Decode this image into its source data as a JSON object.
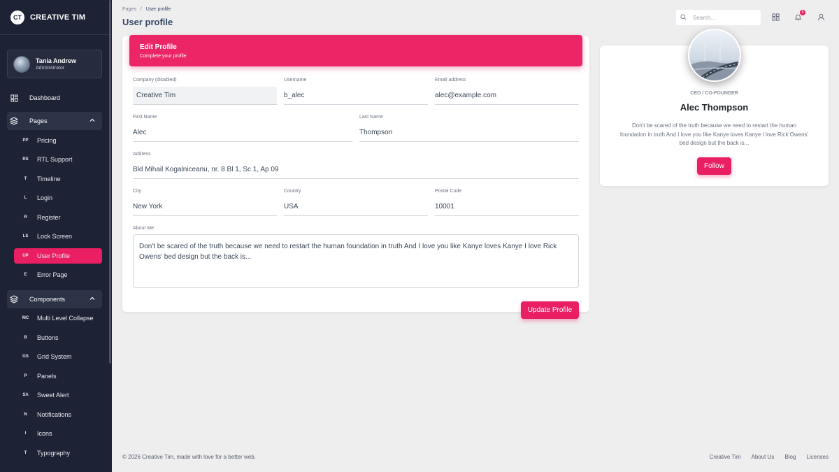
{
  "brand": {
    "logo": "CT",
    "name": "CREATIVE TIM"
  },
  "user": {
    "name": "Tania Andrew",
    "role": "Administrator"
  },
  "nav": {
    "dashboard": "Dashboard",
    "pages": "Pages",
    "components": "Components",
    "pages_items": [
      {
        "abbr": "PP",
        "label": "Pricing"
      },
      {
        "abbr": "RS",
        "label": "RTL Support"
      },
      {
        "abbr": "T",
        "label": "Timeline"
      },
      {
        "abbr": "L",
        "label": "Login"
      },
      {
        "abbr": "R",
        "label": "Register"
      },
      {
        "abbr": "LS",
        "label": "Lock Screen"
      },
      {
        "abbr": "UP",
        "label": "User Profile"
      },
      {
        "abbr": "E",
        "label": "Error Page"
      }
    ],
    "component_items": [
      {
        "abbr": "MC",
        "label": "Multi Level Collapse"
      },
      {
        "abbr": "B",
        "label": "Buttons"
      },
      {
        "abbr": "GS",
        "label": "Grid System"
      },
      {
        "abbr": "P",
        "label": "Panels"
      },
      {
        "abbr": "SA",
        "label": "Sweet Alert"
      },
      {
        "abbr": "N",
        "label": "Notifications"
      },
      {
        "abbr": "I",
        "label": "Icons"
      },
      {
        "abbr": "T",
        "label": "Typography"
      }
    ]
  },
  "header": {
    "breadcrumb_root": "Pages",
    "breadcrumb_sep": "/",
    "breadcrumb_current": "User profile",
    "title": "User profile",
    "search_placeholder": "Search...",
    "notification_count": "5"
  },
  "edit_profile": {
    "title": "Edit Profile",
    "subtitle": "Complete your profile",
    "company_label": "Company (disabled)",
    "company_value": "Creative Tim",
    "username_label": "Username",
    "username_value": "b_alec",
    "email_label": "Email address",
    "email_value": "alec@example.com",
    "first_label": "First Name",
    "first_value": "Alec",
    "last_label": "Last Name",
    "last_value": "Thompson",
    "address_label": "Address",
    "address_value": "Bld Mihail Kogalniceanu, nr. 8 Bl 1, Sc 1, Ap 09",
    "city_label": "City",
    "city_value": "New York",
    "country_label": "Country",
    "country_value": "USA",
    "postal_label": "Postal Code",
    "postal_value": "10001",
    "about_label": "About Me",
    "about_value": "Don't be scared of the truth because we need to restart the human foundation in truth And I love you like Kanye loves Kanye I love Rick Owens' bed design but the back is...",
    "submit_label": "Update Profile"
  },
  "profile": {
    "role": "CEO / CO-FOUNDER",
    "name": "Alec Thompson",
    "description": "Don't be scared of the truth because we need to restart the human foundation in truth And I love you like Kanye loves Kanye I love Rick Owens' bed design but the back is...",
    "follow_label": "Follow"
  },
  "footer": {
    "copyright": "© 2026 Creative Tim, made with love for a better web.",
    "links": [
      "Creative Tim",
      "About Us",
      "Blog",
      "Licenses"
    ]
  },
  "colors": {
    "accent": "#e91e63",
    "sidebar": "#1d2235",
    "background": "#eeeeef"
  }
}
